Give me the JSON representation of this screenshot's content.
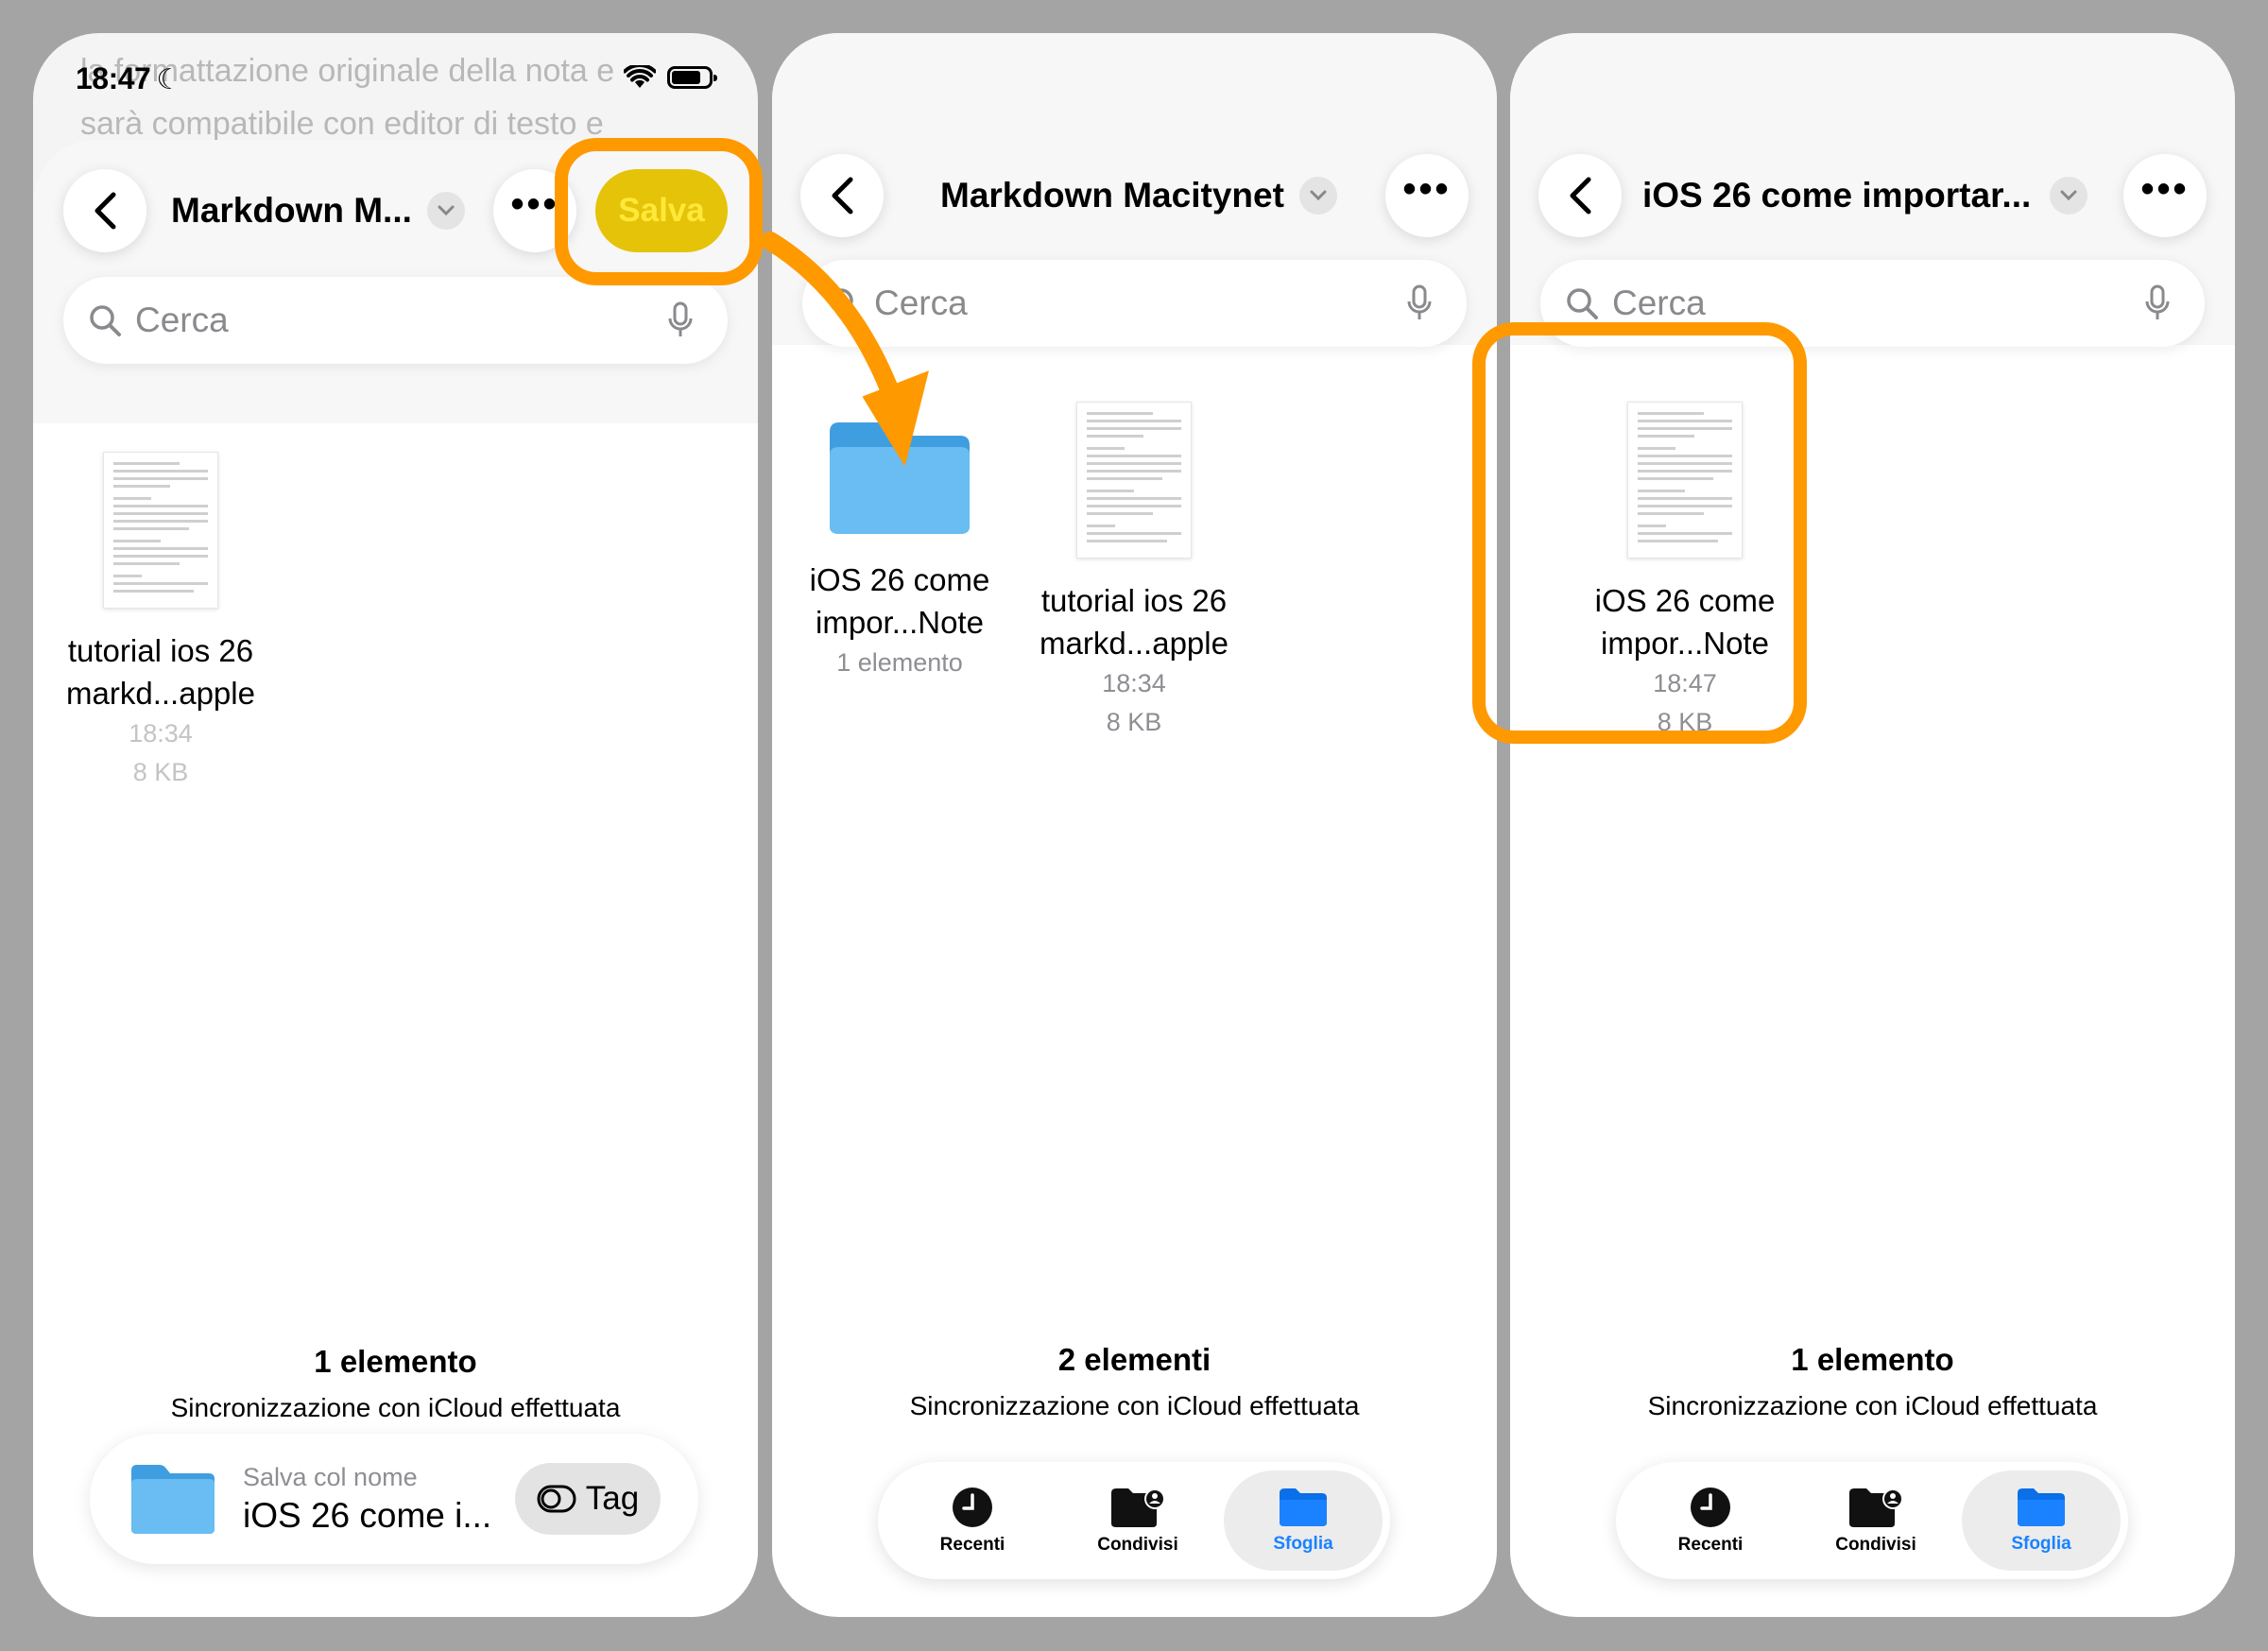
{
  "status": {
    "time": "18:47"
  },
  "colors": {
    "highlight": "#ff9900",
    "folder": "#5ab4ee",
    "tab_active": "#1a82ff",
    "salva": "#e5c308"
  },
  "screen1": {
    "background_text": [
      "la formattazione originale della nota e",
      "sarà compatibile con editor di testo e"
    ],
    "nav_title": "Markdown M...",
    "save_button": "Salva",
    "search_placeholder": "Cerca",
    "file": {
      "name_line1": "tutorial ios 26",
      "name_line2": "markd...apple",
      "time": "18:34",
      "size": "8 KB"
    },
    "count": "1 elemento",
    "sync": "Sincronizzazione con iCloud effettuata",
    "save_as_label": "Salva col nome",
    "save_as_name": "iOS 26 come i...",
    "tag_label": "Tag"
  },
  "screen2": {
    "nav_title": "Markdown Macitynet",
    "search_placeholder": "Cerca",
    "folder": {
      "name_line1": "iOS 26 come",
      "name_line2": "impor...Note",
      "meta": "1 elemento"
    },
    "file": {
      "name_line1": "tutorial ios 26",
      "name_line2": "markd...apple",
      "time": "18:34",
      "size": "8 KB"
    },
    "count": "2 elementi",
    "sync": "Sincronizzazione con iCloud effettuata"
  },
  "screen3": {
    "nav_title": "iOS 26 come importar...",
    "search_placeholder": "Cerca",
    "file": {
      "name_line1": "iOS 26 come",
      "name_line2": "impor...Note",
      "time": "18:47",
      "size": "8 KB"
    },
    "count": "1 elemento",
    "sync": "Sincronizzazione con iCloud effettuata"
  },
  "tabbar": {
    "recents": "Recenti",
    "shared": "Condivisi",
    "browse": "Sfoglia"
  }
}
